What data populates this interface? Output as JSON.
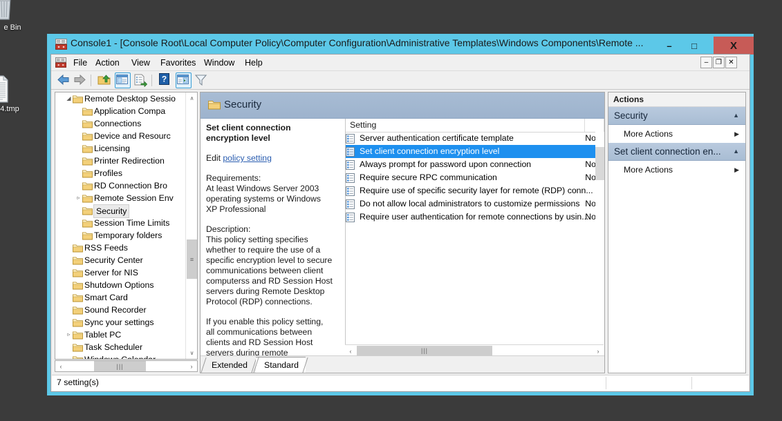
{
  "desktop": {
    "icons": [
      {
        "name": "recycle-bin",
        "label": "e Bin",
        "icon": "recycle-bin-icon"
      },
      {
        "name": "tmp-file",
        "label": "4.tmp",
        "icon": "text-file-icon"
      }
    ],
    "background_color": "#3b3b3b"
  },
  "window": {
    "title": "Console1 - [Console Root\\Local Computer Policy\\Computer Configuration\\Administrative Templates\\Windows Components\\Remote ...",
    "app_icon": "mmc-console-icon",
    "accent_color": "#5cc8e8",
    "close_button_color": "#c75b57",
    "caption_buttons": [
      {
        "name": "minimize-button",
        "glyph": "–"
      },
      {
        "name": "maximize-button",
        "glyph": "□"
      },
      {
        "name": "close-button",
        "glyph": "X"
      }
    ]
  },
  "menu": {
    "icon": "mdi-console-icon",
    "items": [
      "File",
      "Action",
      "View",
      "Favorites",
      "Window",
      "Help"
    ],
    "mdi_buttons": [
      {
        "name": "mdi-minimize-button",
        "glyph": "–"
      },
      {
        "name": "mdi-restore-button",
        "glyph": "❐"
      },
      {
        "name": "mdi-close-button",
        "glyph": "✕"
      }
    ]
  },
  "toolbar": {
    "buttons": [
      {
        "name": "back-button",
        "icon": "back-arrow-icon",
        "active": false
      },
      {
        "name": "forward-button",
        "icon": "forward-arrow-icon",
        "active": false
      },
      {
        "name": "up-one-level-button",
        "icon": "folder-up-icon",
        "active": false
      },
      {
        "name": "show-hide-console-tree-button",
        "icon": "console-tree-icon",
        "active": true
      },
      {
        "name": "export-list-button",
        "icon": "export-list-icon",
        "active": false
      },
      {
        "name": "help-button",
        "icon": "help-question-icon",
        "active": false
      },
      {
        "name": "show-hide-action-pane-button",
        "icon": "action-pane-icon",
        "active": true
      },
      {
        "name": "filter-button",
        "icon": "funnel-filter-icon",
        "active": false
      }
    ]
  },
  "tree": {
    "nodes": [
      {
        "label": "Remote Desktop Sessio",
        "indent": 1,
        "expander": "expanded",
        "selected": false
      },
      {
        "label": "Application Compa",
        "indent": 2,
        "expander": "none",
        "selected": false
      },
      {
        "label": "Connections",
        "indent": 2,
        "expander": "none",
        "selected": false
      },
      {
        "label": "Device and Resourc",
        "indent": 2,
        "expander": "none",
        "selected": false
      },
      {
        "label": "Licensing",
        "indent": 2,
        "expander": "none",
        "selected": false
      },
      {
        "label": "Printer Redirection",
        "indent": 2,
        "expander": "none",
        "selected": false
      },
      {
        "label": "Profiles",
        "indent": 2,
        "expander": "none",
        "selected": false
      },
      {
        "label": "RD Connection Bro",
        "indent": 2,
        "expander": "none",
        "selected": false
      },
      {
        "label": "Remote Session Env",
        "indent": 2,
        "expander": "collapsed",
        "selected": false
      },
      {
        "label": "Security",
        "indent": 2,
        "expander": "none",
        "selected": true
      },
      {
        "label": "Session Time Limits",
        "indent": 2,
        "expander": "none",
        "selected": false
      },
      {
        "label": "Temporary folders",
        "indent": 2,
        "expander": "none",
        "selected": false
      },
      {
        "label": "RSS Feeds",
        "indent": 1,
        "expander": "none",
        "selected": false
      },
      {
        "label": "Security Center",
        "indent": 1,
        "expander": "none",
        "selected": false
      },
      {
        "label": "Server for NIS",
        "indent": 1,
        "expander": "none",
        "selected": false
      },
      {
        "label": "Shutdown Options",
        "indent": 1,
        "expander": "none",
        "selected": false
      },
      {
        "label": "Smart Card",
        "indent": 1,
        "expander": "none",
        "selected": false
      },
      {
        "label": "Sound Recorder",
        "indent": 1,
        "expander": "none",
        "selected": false
      },
      {
        "label": "Sync your settings",
        "indent": 1,
        "expander": "none",
        "selected": false
      },
      {
        "label": "Tablet PC",
        "indent": 1,
        "expander": "collapsed",
        "selected": false
      },
      {
        "label": "Task Scheduler",
        "indent": 1,
        "expander": "none",
        "selected": false
      },
      {
        "label": "Windows Calendar",
        "indent": 1,
        "expander": "none",
        "selected": false
      }
    ],
    "vscroll": {
      "up": "∧",
      "down": "∨",
      "thumb": "≡"
    },
    "hscroll": {
      "left": "‹",
      "right": "›",
      "thumb": "|||"
    }
  },
  "center": {
    "header": {
      "icon": "folder-icon",
      "title": "Security"
    },
    "description": {
      "title": "Set client connection encryption level",
      "edit_prefix": "Edit ",
      "edit_link": "policy setting ",
      "requirements_label": "Requirements:",
      "requirements_text": "At least Windows Server 2003 operating systems or Windows XP Professional",
      "description_label": "Description:",
      "description_text": "This policy setting specifies whether to require the use of a specific encryption level to secure communications between client computerss and RD Session Host servers during Remote Desktop Protocol (RDP) connections.",
      "description_text2": "If you enable this policy setting, all communications between clients and RD Session Host servers during remote connections must"
    },
    "list": {
      "columns": [
        "Setting",
        ""
      ],
      "rows": [
        {
          "name": "Server authentication certificate template",
          "state": "No",
          "selected": false
        },
        {
          "name": "Set client connection encryption level",
          "state": "",
          "selected": true
        },
        {
          "name": "Always prompt for password upon connection",
          "state": "No",
          "selected": false
        },
        {
          "name": "Require secure RPC communication",
          "state": "No",
          "selected": false
        },
        {
          "name": "Require use of specific security layer for remote (RDP) conn...",
          "state": "",
          "selected": false
        },
        {
          "name": "Do not allow local administrators to customize permissions",
          "state": "No",
          "selected": false
        },
        {
          "name": "Require user authentication for remote connections by usin...",
          "state": "No",
          "selected": false
        }
      ]
    },
    "hscroll": {
      "left": "‹",
      "right": "›",
      "thumb": "|||"
    },
    "tabs": [
      {
        "label": "Extended",
        "active": false
      },
      {
        "label": "Standard",
        "active": true
      }
    ]
  },
  "actions": {
    "title": "Actions",
    "groups": [
      {
        "header": "Security",
        "chevron": "▲",
        "items": [
          {
            "label": "More Actions",
            "arrow": "▶"
          }
        ]
      },
      {
        "header": "Set client connection en...",
        "chevron": "▲",
        "items": [
          {
            "label": "More Actions",
            "arrow": "▶"
          }
        ]
      }
    ]
  },
  "status": {
    "text": "7 setting(s)"
  }
}
